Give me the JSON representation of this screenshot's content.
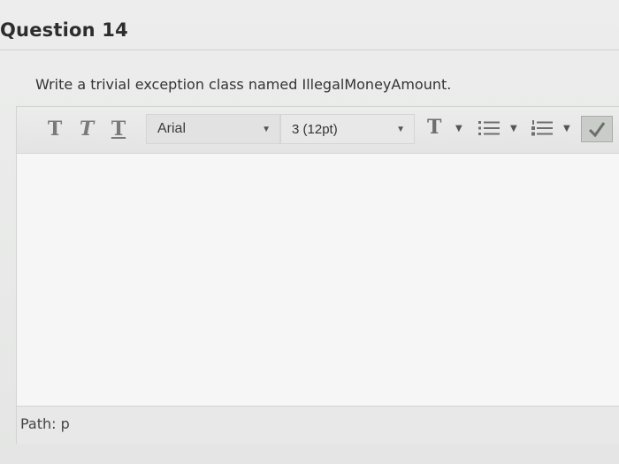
{
  "question": {
    "title": "Question 14",
    "text": "Write a trivial exception class named IllegalMoneyAmount."
  },
  "toolbar": {
    "bold_label": "T",
    "italic_label": "T",
    "underline_label": "T",
    "font_family": "Arial",
    "font_size": "3 (12pt)",
    "text_color_label": "T",
    "icons": {
      "caret": "chevron-down-icon",
      "bullet_list": "bullet-list-icon",
      "numbered_list": "numbered-list-icon",
      "spellcheck": "spellcheck-icon"
    },
    "caret_glyph": "▼"
  },
  "editor": {
    "content": ""
  },
  "status": {
    "path": "Path: p"
  }
}
